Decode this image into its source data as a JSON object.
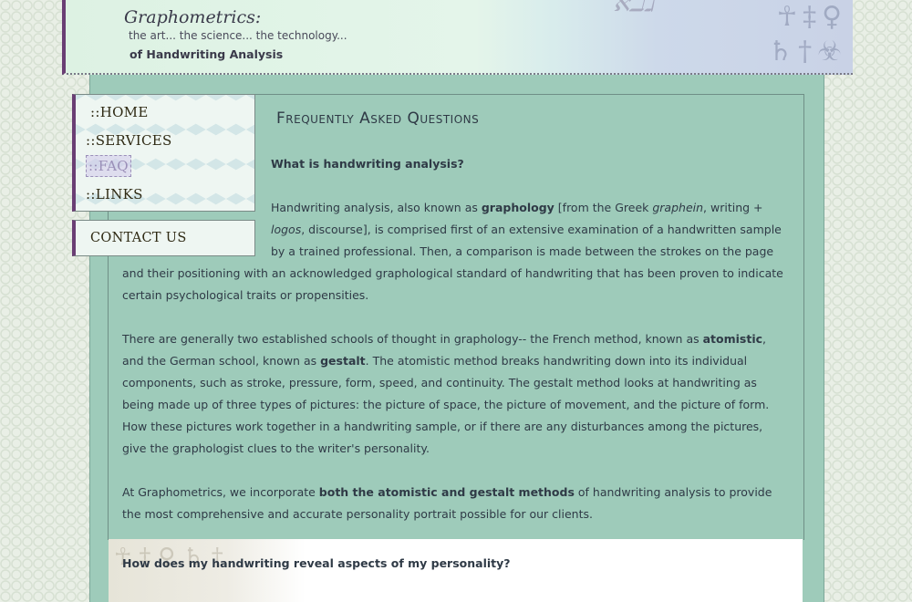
{
  "header": {
    "logo": "Graphometrics:",
    "tagline": "the art... the science... the technology...",
    "subtitle": "of Handwriting Analysis"
  },
  "nav": {
    "home": "::HOME",
    "services": "::SERVICES",
    "faq": "::FAQ",
    "links": "::LINKS",
    "contact": "CONTACT US"
  },
  "main": {
    "title": "Frequently Asked Questions",
    "q1": "What is handwriting analysis?",
    "p1": {
      "t1": "Handwriting analysis, also known as ",
      "b1": "graphology",
      "t2": " [from the Greek ",
      "i1": "graphein",
      "t3": ", writing + ",
      "i2": "logos",
      "t4": ", discourse], is comprised first of an extensive examination of a handwritten sample by a trained professional. Then, a comparison is made between the strokes on the page and their positioning with an acknowledged graphological standard of handwriting that has been proven to indicate certain psychological traits or propensities."
    },
    "p2": {
      "t1": "There are generally two established schools of thought in graphology-- the French method, known as ",
      "b1": "atomistic",
      "t2": ", and the German school, known as ",
      "b2": "gestalt",
      "t3": ". The atomistic method breaks handwriting down into its individual components, such as stroke, pressure, form, speed, and continuity. The gestalt method looks at handwriting as being made up of three types of pictures: the picture of space, the picture of movement, and the picture of form. How these pictures work together in a handwriting sample, or if there are any disturbances among the pictures, give the graphologist clues to the writer's personality."
    },
    "p3": {
      "t1": "At Graphometrics, we incorporate ",
      "b1": "both the atomistic and gestalt methods",
      "t2": " of handwriting analysis to provide the most comprehensive and accurate personality portrait possible for our clients."
    },
    "q2": "How does my handwriting reveal aspects of my personality?"
  },
  "colors": {
    "panel": "#9ecbba",
    "accent": "#6a3e74",
    "text": "#2f3a46"
  }
}
